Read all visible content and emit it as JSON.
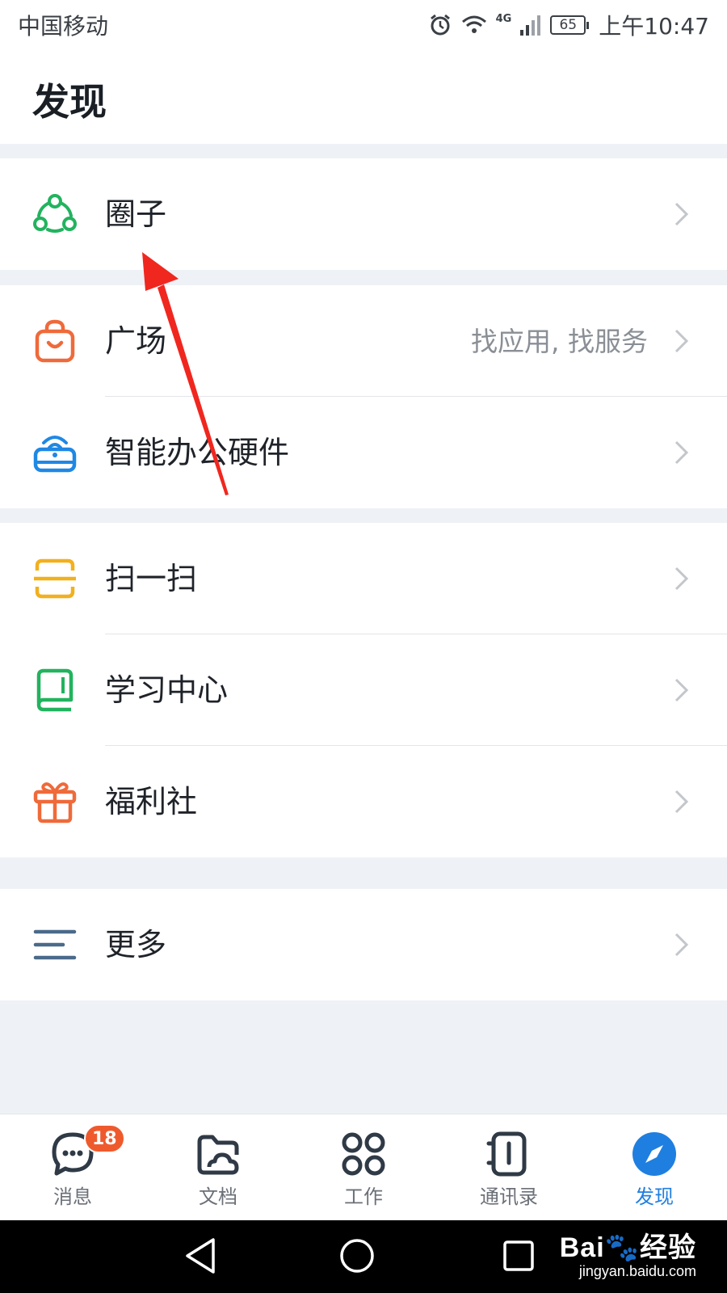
{
  "status_bar": {
    "carrier": "中国移动",
    "network": "4G",
    "battery": "65",
    "time": "上午10:47"
  },
  "page": {
    "title": "发现"
  },
  "groups": [
    {
      "items": [
        {
          "label": "圈子",
          "icon": "circle-group-icon",
          "color": "#22b35e"
        }
      ]
    },
    {
      "items": [
        {
          "label": "广场",
          "subtitle": "找应用, 找服务",
          "icon": "shopping-bag-icon",
          "color": "#ef6a3a"
        },
        {
          "label": "智能办公硬件",
          "icon": "smart-device-icon",
          "color": "#1f88e5"
        }
      ]
    },
    {
      "items": [
        {
          "label": "扫一扫",
          "icon": "scan-icon",
          "color": "#f2b01e"
        },
        {
          "label": "学习中心",
          "icon": "book-icon",
          "color": "#22b35e"
        },
        {
          "label": "福利社",
          "icon": "gift-icon",
          "color": "#ef6a3a"
        }
      ]
    },
    {
      "items": [
        {
          "label": "更多",
          "icon": "menu-icon",
          "color": "#4a6a8a"
        }
      ]
    }
  ],
  "bottom_nav": {
    "items": [
      {
        "label": "消息",
        "icon": "chat-bubble-icon",
        "badge": "18"
      },
      {
        "label": "文档",
        "icon": "folder-icon"
      },
      {
        "label": "工作",
        "icon": "grid-icon"
      },
      {
        "label": "通讯录",
        "icon": "contacts-book-icon"
      },
      {
        "label": "发现",
        "icon": "compass-icon",
        "active": true
      }
    ],
    "active_color": "#1f7fe0"
  },
  "watermark": {
    "brand": "Bai🐾经验",
    "url": "jingyan.baidu.com"
  },
  "annotation": {
    "arrow_color": "#f0271f"
  }
}
